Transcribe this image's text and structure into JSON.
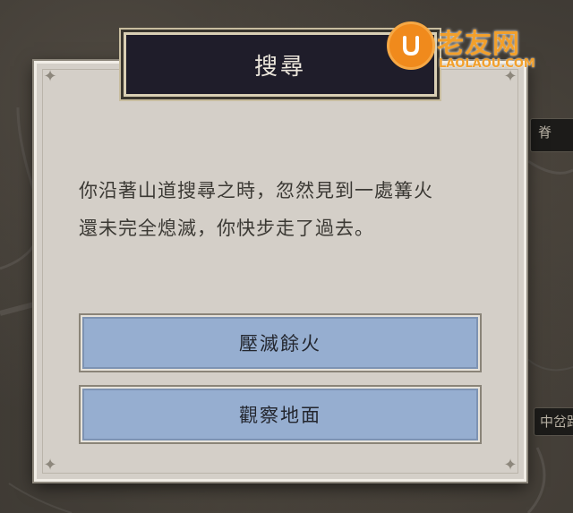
{
  "dialog": {
    "title": "搜尋",
    "message_lines": [
      "你沿著山道搜尋之時，忽然見到一處篝火",
      "還未完全熄滅，你快步走了過去。"
    ],
    "choices": [
      {
        "label": "壓滅餘火"
      },
      {
        "label": "觀察地面"
      }
    ]
  },
  "map": {
    "labels": {
      "right_top": "脊",
      "right_mid": "中岔路"
    }
  },
  "watermark": {
    "title": "老友网",
    "subtitle": "LAOLAOU.COM",
    "logo_letter": "U"
  },
  "colors": {
    "dialog_bg": "#d4cfc8",
    "title_plate_bg": "#1f1d2a",
    "choice_bg": "#96aed0",
    "watermark": "#f08a1c"
  }
}
